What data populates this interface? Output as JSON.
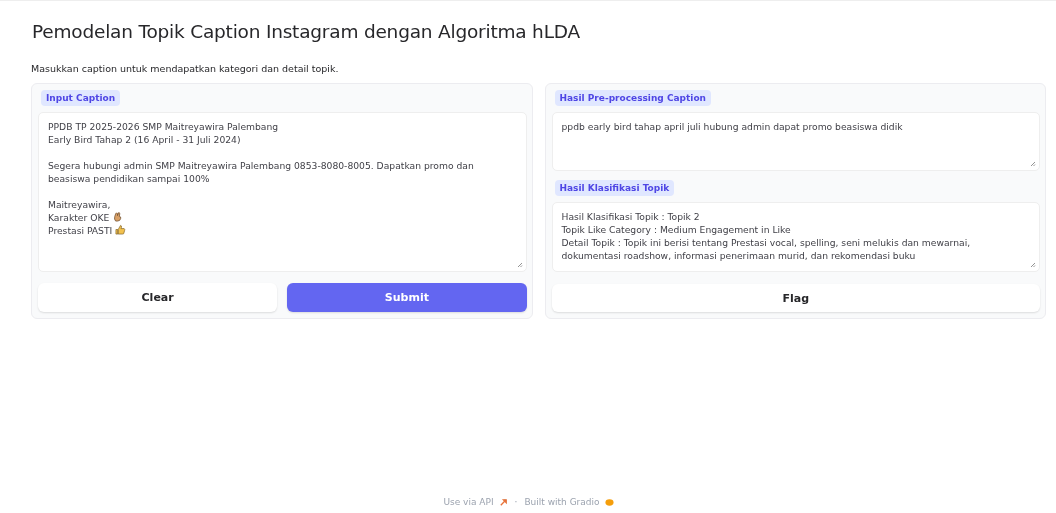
{
  "title": "Pemodelan Topik Caption Instagram dengan Algoritma hLDA",
  "description": "Masukkan caption untuk mendapatkan kategori dan detail topik.",
  "input": {
    "label": "Input Caption",
    "lines": [
      {
        "kind": "plain",
        "text": "PPDB TP 2025-2026 SMP Maitreyawira Palembang"
      },
      {
        "kind": "plain",
        "text": "Early Bird Tahap 2 (16 April - 31 Juli 2024)"
      },
      {
        "kind": "blank"
      },
      {
        "kind": "plain",
        "text": "Segera hubungi admin SMP Maitreyawira Palembang 0853-8080-8005. Dapatkan promo dan beasiswa pendidikan sampai 100%"
      },
      {
        "kind": "blank"
      },
      {
        "kind": "plain",
        "text": "Maitreyawira,"
      },
      {
        "kind": "hand",
        "text": "Karakter OKE"
      },
      {
        "kind": "thumbs",
        "text": "Prestasi PASTI"
      }
    ]
  },
  "buttons": [
    {
      "label": "Clear",
      "kind": "secondary"
    },
    {
      "label": "Submit",
      "kind": "primary"
    }
  ],
  "outputs": [
    {
      "label": "Hasil Pre-processing Caption",
      "lines": [
        "ppdb early bird tahap april juli hubung admin dapat promo beasiswa didik"
      ]
    },
    {
      "label": "Hasil Klasifikasi Topik",
      "lines": [
        "Hasil Klasifikasi Topik : Topik 2",
        "Topik Like Category : Medium Engagement in Like",
        "Detail Topik : Topik ini berisi tentang Prestasi vocal, spelling, seni melukis dan mewarnai, dokumentasi roadshow, informasi penerimaan murid, dan rekomendasi buku"
      ]
    }
  ],
  "flag_button": "Flag",
  "footer": {
    "api_link": "Use via API",
    "separator": "·",
    "built_with": "Built with Gradio"
  }
}
